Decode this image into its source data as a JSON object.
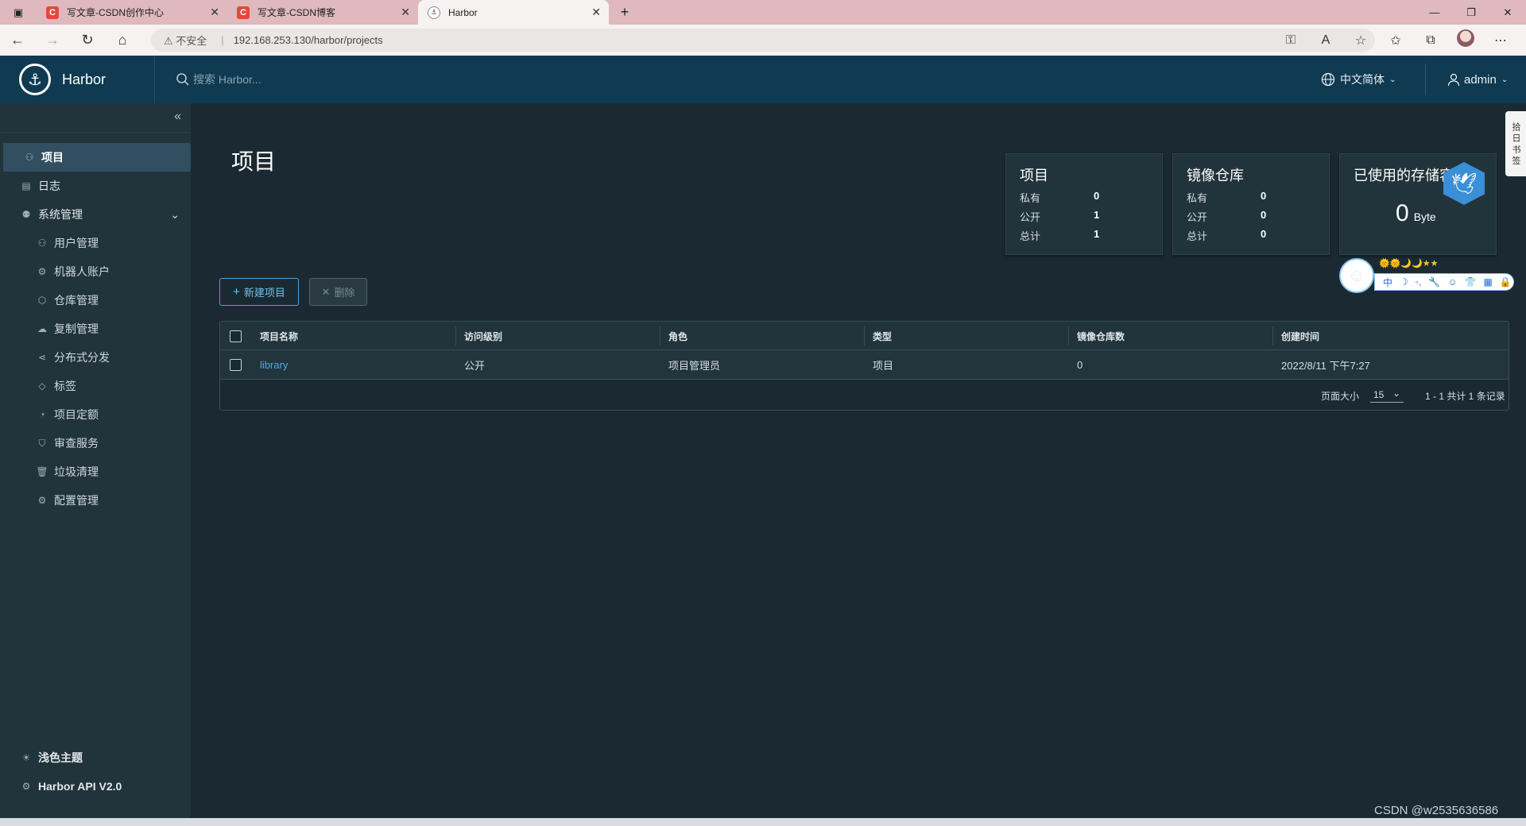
{
  "browser": {
    "tabs": [
      {
        "title": "写文章-CSDN创作中心",
        "icon": "C"
      },
      {
        "title": "写文章-CSDN博客",
        "icon": "C"
      },
      {
        "title": "Harbor",
        "icon": "harbor"
      }
    ],
    "new_tab": "+",
    "url_warning": "不安全",
    "url": "192.168.253.130/harbor/projects"
  },
  "header": {
    "brand": "Harbor",
    "search_placeholder": "搜索 Harbor...",
    "language": "中文简体",
    "user": "admin"
  },
  "sidebar": {
    "items": [
      {
        "label": "项目",
        "icon": "projects-icon",
        "active": true
      },
      {
        "label": "日志",
        "icon": "logs-icon"
      },
      {
        "label": "系统管理",
        "icon": "admin-icon"
      }
    ],
    "subitems": [
      {
        "label": "用户管理",
        "icon": "users-icon"
      },
      {
        "label": "机器人账户",
        "icon": "robot-icon"
      },
      {
        "label": "仓库管理",
        "icon": "registry-icon"
      },
      {
        "label": "复制管理",
        "icon": "replication-icon"
      },
      {
        "label": "分布式分发",
        "icon": "distribution-icon"
      },
      {
        "label": "标签",
        "icon": "tag-icon"
      },
      {
        "label": "项目定额",
        "icon": "quota-icon"
      },
      {
        "label": "审查服务",
        "icon": "shield-icon"
      },
      {
        "label": "垃圾清理",
        "icon": "trash-icon"
      },
      {
        "label": "配置管理",
        "icon": "gear-icon"
      }
    ],
    "footer": [
      {
        "label": "浅色主题",
        "icon": "sun-icon"
      },
      {
        "label": "Harbor API V2.0",
        "icon": "api-icon"
      }
    ]
  },
  "main": {
    "title": "项目",
    "cards": {
      "projects": {
        "title": "项目",
        "rows": [
          {
            "label": "私有",
            "value": "0"
          },
          {
            "label": "公开",
            "value": "1"
          },
          {
            "label": "总计",
            "value": "1"
          }
        ]
      },
      "repos": {
        "title": "镜像仓库",
        "rows": [
          {
            "label": "私有",
            "value": "0"
          },
          {
            "label": "公开",
            "value": "0"
          },
          {
            "label": "总计",
            "value": "0"
          }
        ]
      },
      "storage": {
        "title": "已使用的存储容",
        "value": "0",
        "unit": "Byte"
      }
    },
    "buttons": {
      "new_project": "新建项目",
      "delete": "删除"
    },
    "table": {
      "columns": [
        "项目名称",
        "访问级别",
        "角色",
        "类型",
        "镜像仓库数",
        "创建时间"
      ],
      "rows": [
        {
          "name": "library",
          "access": "公开",
          "role": "项目管理员",
          "type": "项目",
          "repo_count": "0",
          "created": "2022/8/11 下午7:27"
        }
      ],
      "page_size_label": "页面大小",
      "page_size": "15",
      "summary": "1 - 1 共计 1 条记录"
    }
  },
  "overlay": {
    "stars": "🌞🌞🌙🌙★★",
    "toolbar": [
      "中",
      "☽",
      "◦,",
      "🔧",
      "☺",
      "👕",
      "▦",
      "🔒"
    ],
    "sidetool": "拾 日 书 签"
  },
  "watermark": "CSDN @w2535636586"
}
